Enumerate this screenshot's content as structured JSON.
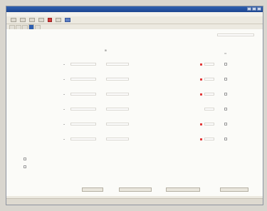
{
  "window": {
    "title": "",
    "menu": [
      "",
      "",
      "",
      "",
      "",
      "",
      ""
    ]
  },
  "tabs": [
    {
      "label": ""
    },
    {
      "label": ""
    },
    {
      "label": ""
    },
    {
      "label": ""
    },
    {
      "label": ""
    }
  ],
  "form": {
    "top_labels": [
      "",
      "",
      "",
      "",
      ""
    ],
    "top_right_label": "",
    "rows": [
      {
        "label": "",
        "value_a": "",
        "value_b": ""
      },
      {
        "label": "",
        "value_a": "",
        "value_b": ""
      },
      {
        "label": "",
        "value_a": "",
        "value_b": ""
      },
      {
        "label": "",
        "value_a": "",
        "value_b": ""
      },
      {
        "label": "",
        "value_a": "",
        "value_b": ""
      },
      {
        "label": "",
        "value_a": "",
        "value_b": ""
      }
    ],
    "checkbox_1": "",
    "checkbox_2": ""
  },
  "buttons": [
    "",
    "",
    "",
    ""
  ],
  "status": [
    "",
    ""
  ]
}
